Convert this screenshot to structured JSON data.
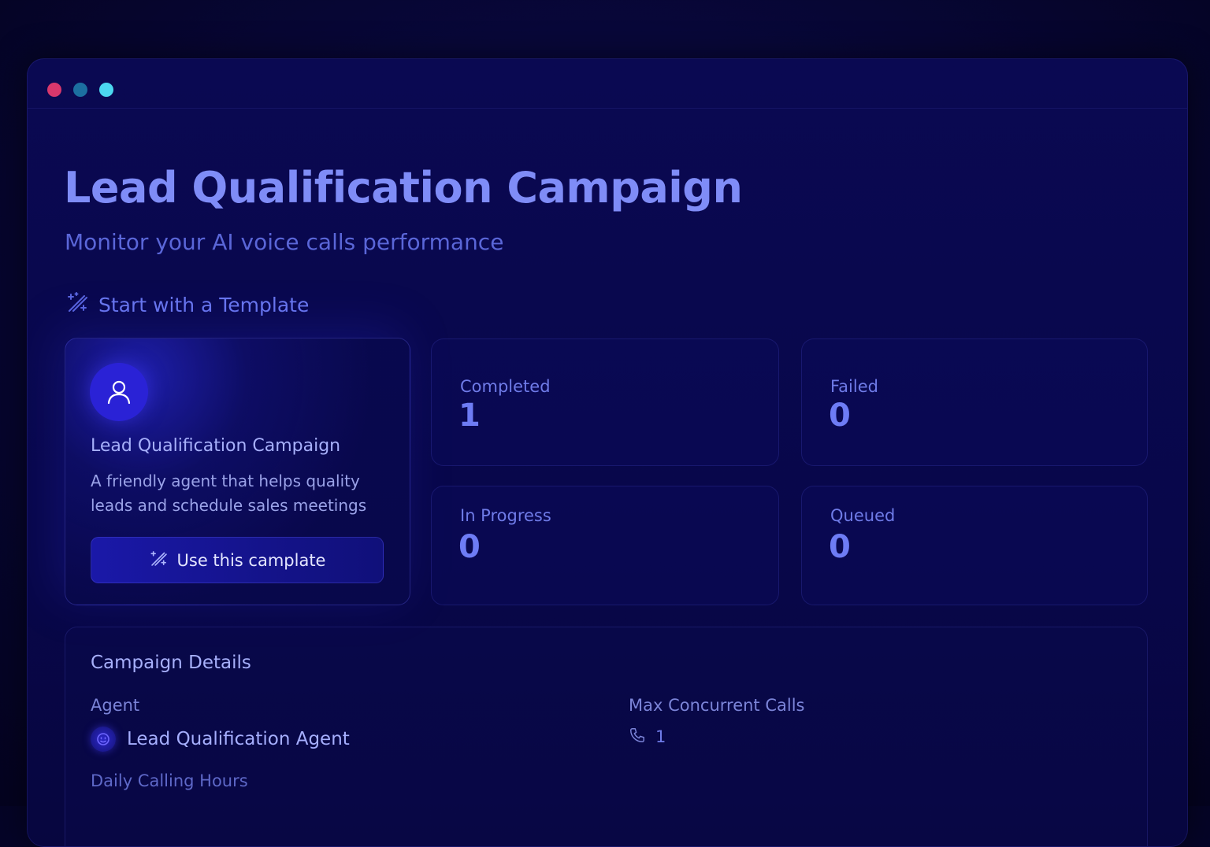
{
  "page": {
    "title": "Lead Qualification Campaign",
    "subtitle": "Monitor your AI voice calls performance"
  },
  "template_section": {
    "heading": "Start with a Template",
    "icon": "magic-wand-icon",
    "card": {
      "icon": "user-icon",
      "title": "Lead Qualification Campaign",
      "description": "A friendly agent that helps quality leads and schedule sales meetings",
      "button_label": "Use this camplate",
      "button_icon": "magic-wand-icon"
    }
  },
  "stats": {
    "completed": {
      "label": "Completed",
      "value": "1"
    },
    "failed": {
      "label": "Failed",
      "value": "0"
    },
    "in_progress": {
      "label": "In Progress",
      "value": "0"
    },
    "queued": {
      "label": "Queued",
      "value": "0"
    }
  },
  "campaign_details": {
    "title": "Campaign Details",
    "agent_label": "Agent",
    "agent_name": "Lead Qualification Agent",
    "max_calls_label": "Max Concurrent Calls",
    "max_calls_value": "1",
    "max_calls_icon": "phone-icon",
    "daily_hours_label": "Daily Calling Hours"
  },
  "colors": {
    "background": "#070634",
    "accent": "#7f8cf7",
    "button": "#1a18a8",
    "window_dot_red": "#d8386c",
    "window_dot_teal": "#1c6fa0",
    "window_dot_cyan": "#4cd8f0"
  }
}
